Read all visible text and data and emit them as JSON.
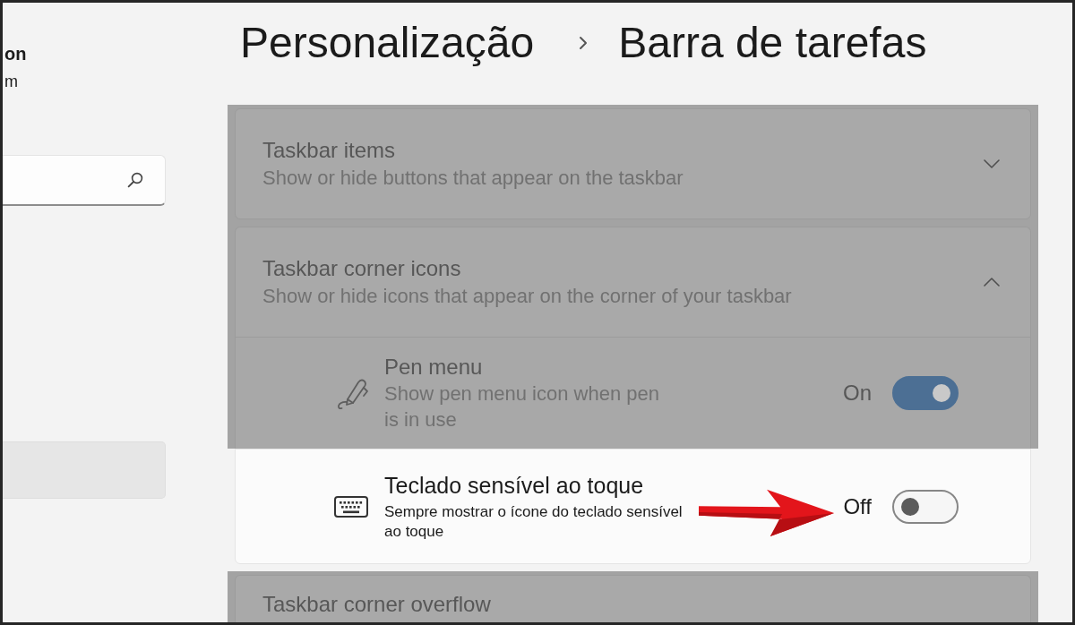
{
  "sidebar": {
    "user_name": "on",
    "user_email": "m",
    "nav_items": [
      {
        "selected": true
      }
    ]
  },
  "breadcrumb": [
    "Personalização",
    "Barra de tarefas"
  ],
  "sections": [
    {
      "kind": "expander",
      "title": "Taskbar items",
      "subtitle": "Show or hide buttons that appear on the taskbar",
      "expanded": false,
      "dimmed": true
    },
    {
      "kind": "expander",
      "title": "Taskbar corner icons",
      "subtitle": "Show or hide icons that appear on the corner of your taskbar",
      "expanded": true,
      "dimmed": true,
      "children": [
        {
          "kind": "toggle",
          "title": "Pen menu",
          "description": "Show pen menu icon when pen is in use",
          "state_label": "On",
          "on": true,
          "dimmed": true,
          "annotated": false
        },
        {
          "kind": "toggle_compact",
          "title": "Teclado sensível ao toque",
          "description": "Sempre mostrar o ícone do teclado sensível ao toque",
          "state_label": "Off",
          "on": false,
          "dimmed": false,
          "annotated": true
        }
      ]
    },
    {
      "kind": "expander",
      "title": "Taskbar corner overflow",
      "dimmed": true
    }
  ]
}
